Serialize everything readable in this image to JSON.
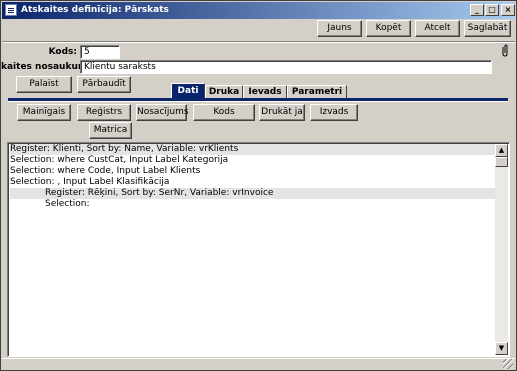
{
  "window": {
    "title": "Atskaites definīcija: Pārskats",
    "minimize": "_",
    "maximize": "□",
    "close": "×"
  },
  "toolbar": {
    "new_label": "Jauns",
    "copy_label": "Kopēt",
    "cancel_label": "Atcelt",
    "save_label": "Saglabāt"
  },
  "form": {
    "code_label": "Kods:",
    "code_value": "5",
    "name_label": "kaites nosaukums:",
    "name_value": "Klientu saraksts"
  },
  "actions": {
    "run_label": "Palaist",
    "check_label": "Pārbaudīt"
  },
  "tabs": [
    {
      "label": "Dati"
    },
    {
      "label": "Druka"
    },
    {
      "label": "Ievads"
    },
    {
      "label": "Parametri"
    }
  ],
  "dati_buttons": {
    "variable": "Mainīgais",
    "register": "Reģistrs",
    "condition": "Nosacījums",
    "code": "Kods",
    "print_if": "Drukāt ja",
    "output": "Izvads",
    "matrix": "Matrica"
  },
  "definition_rows": [
    {
      "text": "Register: Klienti, Sort by: Name, Variable: vrKlients"
    },
    {
      "text": "Selection: where CustCat, Input Label Kategorija"
    },
    {
      "text": "Selection: where Code, Input Label Klients"
    },
    {
      "text": "Selection: , Input Label Klasifikācija"
    },
    {
      "text": "Register: Rēķini, Sort by: SerNr, Variable: vrInvoice"
    },
    {
      "text": "Selection:"
    }
  ],
  "scrollbar": {
    "up": "▲",
    "down": "▼"
  },
  "icons": {
    "attachment": "paperclip-icon"
  }
}
